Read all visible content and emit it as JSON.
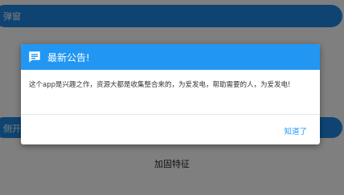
{
  "background": {
    "top_item_label": "弹窗",
    "middle_item_label": "侧开",
    "bottom_item_label": "加固特征"
  },
  "dialog": {
    "icon": "message-icon",
    "title": "最新公告!",
    "message": "这个app是兴趣之作，资源大都是收集整合来的，为爱发电，帮助需要的人，为爱发电!",
    "ok_label": "知道了"
  },
  "colors": {
    "accent": "#2196f3",
    "bg_pill": "#1e88e5"
  }
}
